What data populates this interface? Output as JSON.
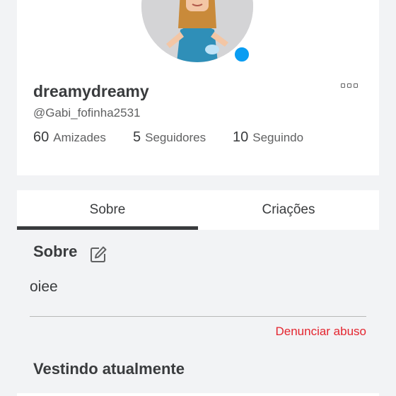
{
  "profile": {
    "display_name": "dreamydreamy",
    "username": "@Gabi_fofinha2531",
    "online_status_color": "#0a9df2",
    "stats": [
      {
        "value": "60",
        "label": "Amizades"
      },
      {
        "value": "5",
        "label": "Seguidores"
      },
      {
        "value": "10",
        "label": "Seguindo"
      }
    ],
    "more_icon": "more-horizontal-icon"
  },
  "tabs": [
    {
      "label": "Sobre",
      "active": true
    },
    {
      "label": "Criações",
      "active": false
    }
  ],
  "about": {
    "title": "Sobre",
    "edit_icon": "edit-icon",
    "text": "oiee",
    "report_label": "Denunciar abuso"
  },
  "wearing": {
    "title": "Vestindo atualmente"
  },
  "colors": {
    "background": "#f2f3f5",
    "card": "#ffffff",
    "text_primary": "#393b3d",
    "text_secondary": "#606162",
    "danger": "#e4252f",
    "online": "#0a9df2"
  }
}
